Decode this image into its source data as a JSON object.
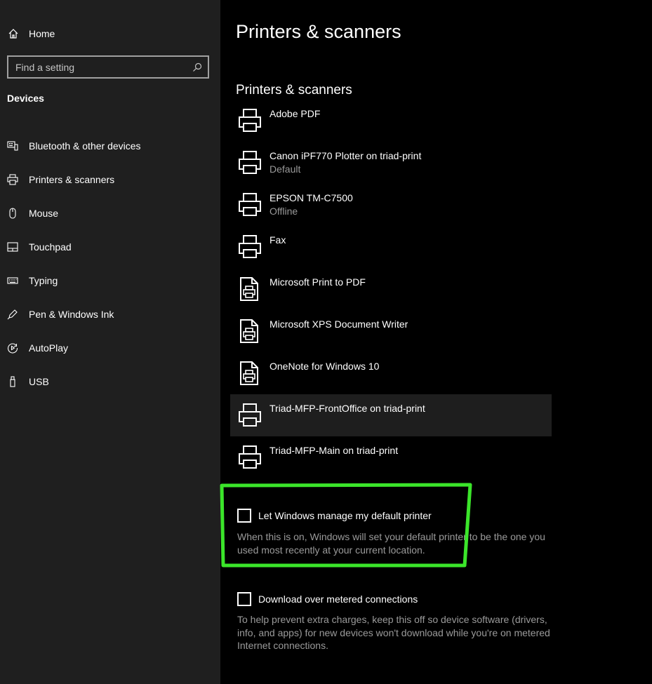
{
  "sidebar": {
    "home_label": "Home",
    "search_placeholder": "Find a setting",
    "section_title": "Devices",
    "items": [
      {
        "label": "Bluetooth & other devices",
        "icon": "bluetooth-devices-icon"
      },
      {
        "label": "Printers & scanners",
        "icon": "printer-icon"
      },
      {
        "label": "Mouse",
        "icon": "mouse-icon"
      },
      {
        "label": "Touchpad",
        "icon": "touchpad-icon"
      },
      {
        "label": "Typing",
        "icon": "keyboard-icon"
      },
      {
        "label": "Pen & Windows Ink",
        "icon": "pen-icon"
      },
      {
        "label": "AutoPlay",
        "icon": "autoplay-icon"
      },
      {
        "label": "USB",
        "icon": "usb-icon"
      }
    ]
  },
  "main": {
    "page_title": "Printers & scanners",
    "section_title": "Printers & scanners",
    "devices": [
      {
        "name": "Adobe PDF",
        "status": "",
        "icon": "printer-icon"
      },
      {
        "name": "Canon iPF770 Plotter on triad-print",
        "status": "Default",
        "icon": "printer-icon"
      },
      {
        "name": "EPSON TM-C7500",
        "status": "Offline",
        "icon": "printer-icon"
      },
      {
        "name": "Fax",
        "status": "",
        "icon": "printer-icon"
      },
      {
        "name": "Microsoft Print to PDF",
        "status": "",
        "icon": "document-printer-icon"
      },
      {
        "name": "Microsoft XPS Document Writer",
        "status": "",
        "icon": "document-printer-icon"
      },
      {
        "name": "OneNote for Windows 10",
        "status": "",
        "icon": "document-printer-icon"
      },
      {
        "name": "Triad-MFP-FrontOffice on triad-print",
        "status": "",
        "icon": "printer-icon"
      },
      {
        "name": "Triad-MFP-Main on triad-print",
        "status": "",
        "icon": "printer-icon"
      }
    ],
    "manage_default": {
      "label": "Let Windows manage my default printer",
      "description": "When this is on, Windows will set your default printer to be the one you used most recently at your current location.",
      "checked": false
    },
    "metered": {
      "label": "Download over metered connections",
      "description": "To help prevent extra charges, keep this off so device software (drivers, info, and apps) for new devices won't download while you're on metered Internet connections.",
      "checked": false
    }
  },
  "colors": {
    "sidebar_bg": "#1f1f1f",
    "main_bg": "#000000",
    "annotation": "#3be52a",
    "selected_row": "#1e1e1e"
  }
}
